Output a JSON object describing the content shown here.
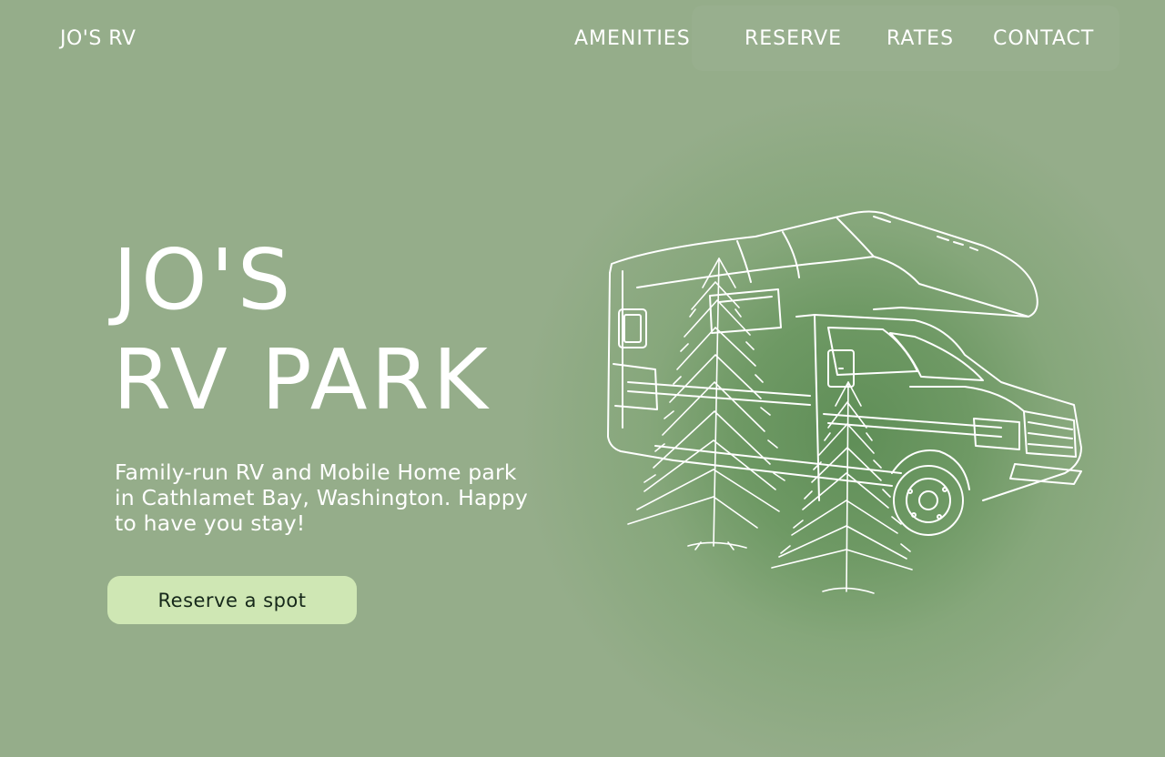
{
  "header": {
    "brand": "JO'S RV",
    "nav": [
      {
        "label": "AMENITIES"
      },
      {
        "label": "RESERVE"
      },
      {
        "label": "RATES"
      },
      {
        "label": "CONTACT"
      }
    ]
  },
  "hero": {
    "title_line1": "JO'S",
    "title_line2": "RV PARK",
    "tagline": "Family-run RV and Mobile Home park in Cathlamet Bay, Washington. Happy to have you stay!",
    "cta_label": "Reserve a spot"
  },
  "illustration": {
    "icon": "rv-with-pine-trees-illustration"
  },
  "colors": {
    "background": "#95ad8a",
    "glow": "#5f8e57",
    "button_bg": "#cfe7b4",
    "button_text": "#16281a",
    "text": "#ffffff"
  }
}
